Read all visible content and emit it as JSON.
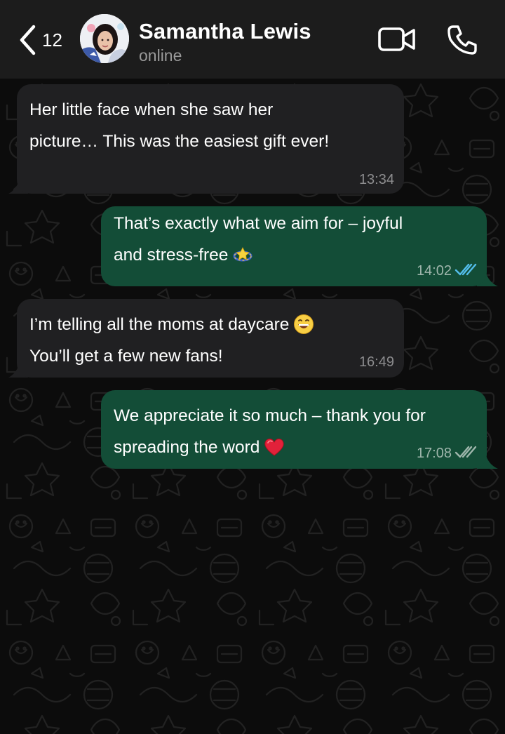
{
  "header": {
    "back_count": "12",
    "contact_name": "Samantha Lewis",
    "contact_status": "online"
  },
  "messages": [
    {
      "direction": "incoming",
      "text": "Her little face when she saw her\npicture…  This was the easiest gift ever!",
      "time": "13:34"
    },
    {
      "direction": "outgoing",
      "text": "That’s exactly what we aim for – joyful\nand stress-free",
      "emoji": "dizzy-star-emoji",
      "time": "14:02",
      "status": "read"
    },
    {
      "direction": "incoming",
      "text": "I’m telling all the moms at daycare",
      "text2": "You’ll get a few new fans!",
      "emoji": "grinning-face-emoji",
      "time": "16:49"
    },
    {
      "direction": "outgoing",
      "text": "We appreciate it so much – thank you for\nspreading the word",
      "emoji": "red-heart-emoji",
      "time": "17:08",
      "status": "delivered"
    }
  ],
  "colors": {
    "header_bg": "#1c1c1c",
    "incoming_bubble": "#202022",
    "outgoing_bubble": "#134d37",
    "read_tick": "#53bdeb",
    "delivered_tick": "#9fb6ac"
  }
}
